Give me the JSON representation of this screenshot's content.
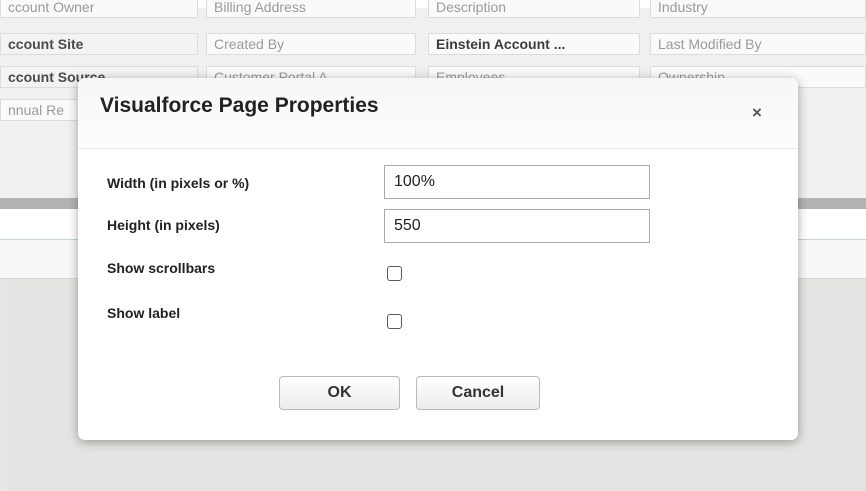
{
  "background": {
    "fields": [
      {
        "id": "account-owner",
        "label": "ccount Owner"
      },
      {
        "id": "billing-address",
        "label": "Billing Address"
      },
      {
        "id": "description",
        "label": "Description"
      },
      {
        "id": "industry",
        "label": "Industry"
      },
      {
        "id": "account-site",
        "label": "ccount Site"
      },
      {
        "id": "created-by",
        "label": "Created By"
      },
      {
        "id": "einstein-account",
        "label": "Einstein Account ..."
      },
      {
        "id": "last-modified-by",
        "label": "Last Modified By"
      },
      {
        "id": "account-source",
        "label": "ccount Source"
      },
      {
        "id": "customer-portal",
        "label": "Customer Portal A..."
      },
      {
        "id": "employees",
        "label": "Employees"
      },
      {
        "id": "ownership",
        "label": "Ownership"
      },
      {
        "id": "annual-revenue",
        "label": "nnual Re"
      }
    ]
  },
  "modal": {
    "title": "Visualforce Page Properties",
    "close_symbol": "×",
    "fields": {
      "width": {
        "label": "Width (in pixels or %)",
        "value": "100%"
      },
      "height": {
        "label": "Height (in pixels)",
        "value": "550"
      },
      "show_scrollbars": {
        "label": "Show scrollbars",
        "checked": false
      },
      "show_label": {
        "label": "Show label",
        "checked": false
      }
    },
    "buttons": {
      "ok": "OK",
      "cancel": "Cancel"
    }
  },
  "icons": {
    "close": "close-icon"
  }
}
